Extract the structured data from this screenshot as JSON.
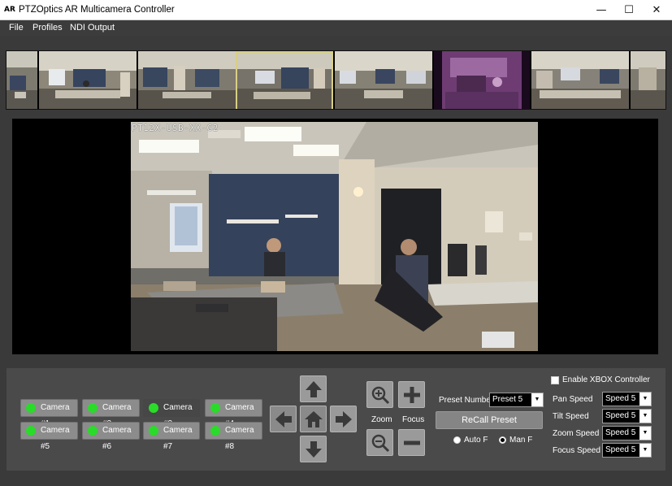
{
  "window": {
    "icon_text": "AR",
    "title": "PTZOptics AR Multicamera Controller",
    "minimize_glyph": "—",
    "maximize_glyph": "☐",
    "close_glyph": "✕"
  },
  "menu": [
    "File",
    "Profiles",
    "NDI Output"
  ],
  "thumbnails": {
    "count": 8,
    "selected_index": 3
  },
  "video": {
    "overlay_text": "PT12X-USB-XX-G2"
  },
  "cameras": [
    {
      "label": "Camera #1",
      "active": false
    },
    {
      "label": "Camera #2",
      "active": false
    },
    {
      "label": "Camera #3",
      "active": true
    },
    {
      "label": "Camera #4",
      "active": false
    },
    {
      "label": "Camera #5",
      "active": false
    },
    {
      "label": "Camera #6",
      "active": false
    },
    {
      "label": "Camera #7",
      "active": false
    },
    {
      "label": "Camera #8",
      "active": false
    }
  ],
  "ptz": {
    "up_icon": "arrow-up-icon",
    "down_icon": "arrow-down-icon",
    "left_icon": "arrow-left-icon",
    "right_icon": "arrow-right-icon",
    "home_icon": "home-icon"
  },
  "zoom": {
    "label": "Zoom"
  },
  "focus": {
    "label": "Focus"
  },
  "preset": {
    "label": "Preset Number",
    "value": "Preset 5",
    "recall_label": "ReCall Preset",
    "auto_focus_label": "Auto F",
    "manual_focus_label": "Man F",
    "manual_selected": true
  },
  "xbox": {
    "label": "Enable XBOX Controller",
    "enabled": false
  },
  "speeds": [
    {
      "label": "Pan Speed",
      "value": "Speed 5"
    },
    {
      "label": "Tilt Speed",
      "value": "Speed 5"
    },
    {
      "label": "Zoom Speed",
      "value": "Speed 5"
    },
    {
      "label": "Focus Speed",
      "value": "Speed 5"
    }
  ],
  "colors": {
    "camera_indicator": "#2adb2a",
    "selected_thumbnail_border": "#d8cf84",
    "panel_background": "#4a4a4a"
  }
}
